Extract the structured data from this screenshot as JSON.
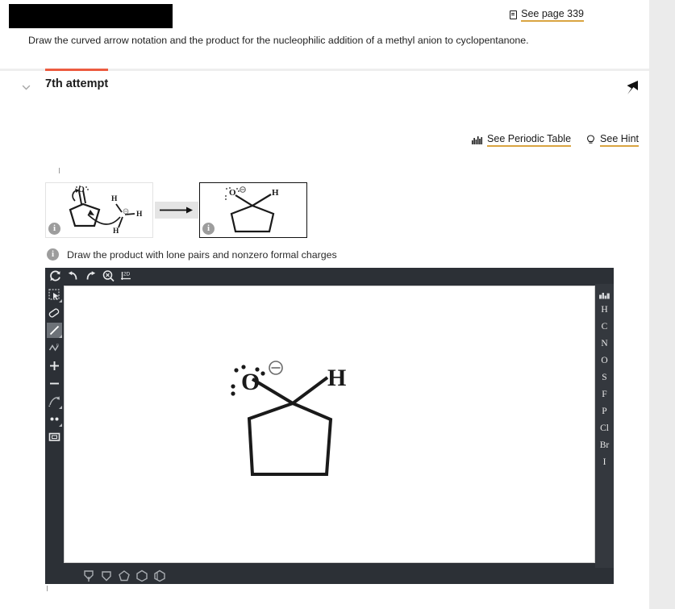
{
  "header": {
    "redacted_label": "",
    "see_page": {
      "icon": "book-icon",
      "label": "See page 339"
    },
    "prompt": "Draw the curved arrow notation and the product for the nucleophilic addition of a methyl anion to cyclopentanone.",
    "attempt": {
      "chevron": "chevron-down-icon",
      "title": "7th attempt"
    },
    "pin": "pin-icon",
    "progress_accent": "#ec5b40"
  },
  "tools": {
    "periodic_table": {
      "icon": "periodic-table-icon",
      "label": "See Periodic Table"
    },
    "hint": {
      "icon": "lightbulb-icon",
      "label": "See Hint"
    },
    "underline_color": "#d9a441"
  },
  "reaction": {
    "reactant": {
      "info": "i",
      "description": "cyclopentanone with curved arrow notation and methyl anion",
      "o_label": "O",
      "h_labels": [
        "H",
        "H",
        "H"
      ],
      "charge": "⊖"
    },
    "arrow": "reaction-arrow-icon",
    "product": {
      "info": "i",
      "description": "cyclopentanolate with O minus and H",
      "o_label": "O",
      "h_label": "H",
      "charge": "⊖"
    }
  },
  "instruction": {
    "info": "i",
    "text": "Draw the product with lone pairs and nonzero formal charges"
  },
  "editor": {
    "top_tools": [
      {
        "name": "reset-icon",
        "label": "Reset"
      },
      {
        "name": "undo-icon",
        "label": "Undo"
      },
      {
        "name": "redo-icon",
        "label": "Redo"
      },
      {
        "name": "erase-zoom-icon",
        "label": "Erase"
      },
      {
        "name": "two-d-icon",
        "label": "2D"
      }
    ],
    "side_tools": [
      {
        "name": "select-marquee-icon",
        "label": "Select",
        "selected": false
      },
      {
        "name": "eraser-icon",
        "label": "Eraser",
        "selected": false
      },
      {
        "name": "single-bond-icon",
        "label": "Single bond",
        "selected": true
      },
      {
        "name": "chain-icon",
        "label": "Chain",
        "selected": false
      },
      {
        "name": "increase-charge-icon",
        "label": "Increase charge",
        "selected": false
      },
      {
        "name": "decrease-charge-icon",
        "label": "Decrease charge",
        "selected": false
      },
      {
        "name": "curved-arrow-icon",
        "label": "Curved arrow",
        "selected": false
      },
      {
        "name": "lone-pair-icon",
        "label": "Lone pair",
        "selected": false
      },
      {
        "name": "rectangle-select-icon",
        "label": "Rectangle",
        "selected": false
      }
    ],
    "elements": [
      "H",
      "C",
      "N",
      "O",
      "S",
      "F",
      "P",
      "Cl",
      "Br",
      "I"
    ],
    "periodic_table_button": "periodic-table-icon",
    "rings": [
      {
        "name": "cyclopropane-template-icon",
        "label": "Cyclopropane"
      },
      {
        "name": "cyclobutane-template-icon",
        "label": "Cyclobutane"
      },
      {
        "name": "cyclopentane-template-icon",
        "label": "Cyclopentane"
      },
      {
        "name": "cyclohexane-template-icon",
        "label": "Cyclohexane"
      },
      {
        "name": "benzene-template-icon",
        "label": "Benzene"
      }
    ],
    "canvas_drawing": {
      "description": "Cyclopentane ring with O minus and H on top carbon",
      "o_label": "O",
      "h_label": "H",
      "charge": "⊖"
    }
  }
}
